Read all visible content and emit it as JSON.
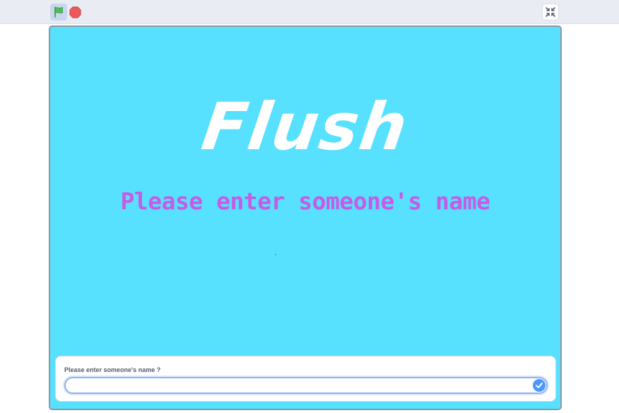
{
  "toolbar": {
    "green_flag_icon": "green-flag-icon",
    "stop_icon": "stop-icon",
    "unfullscreen_icon": "unfullscreen-icon"
  },
  "stage": {
    "title": "Flush",
    "prompt": "Please enter someone's name"
  },
  "ask": {
    "question": "Please enter someone's name ?",
    "value": "",
    "submit_icon": "check-icon"
  },
  "colors": {
    "stage_background": "#57e1ff",
    "title": "#ffffff",
    "prompt": "#c55be6",
    "accent": "#4c97ff",
    "flag": "#4cbf56",
    "stop": "#ec5959"
  }
}
